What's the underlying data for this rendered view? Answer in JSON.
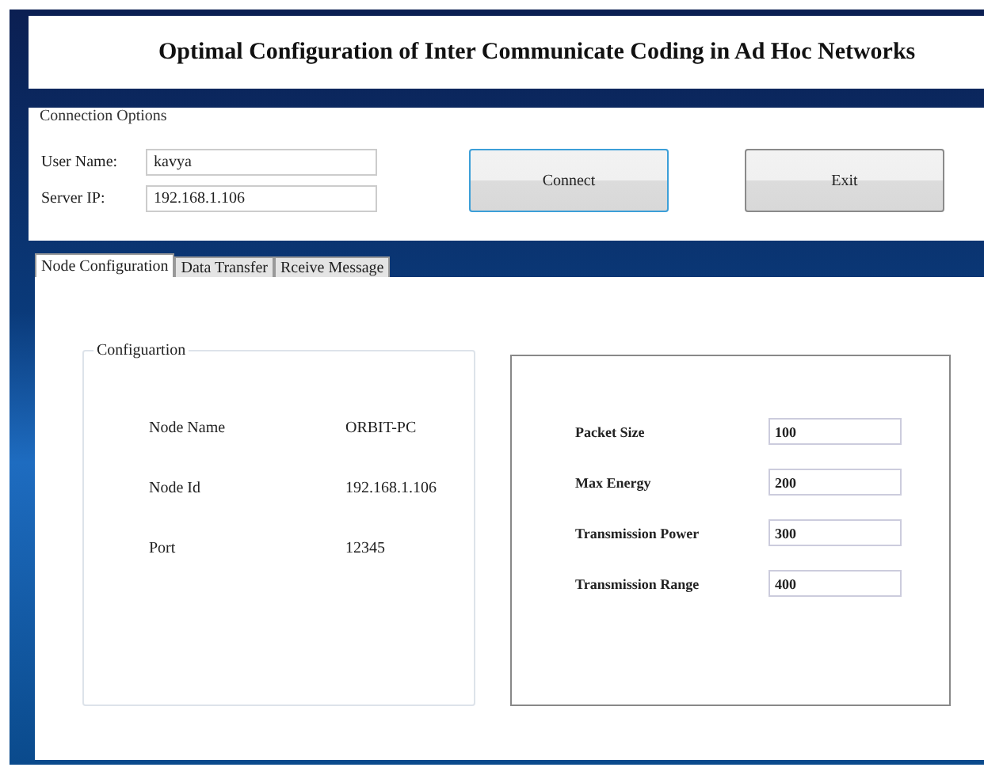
{
  "title": "Optimal Configuration of Inter Communicate  Coding in Ad Hoc Networks",
  "connection": {
    "legend": "Connection Options",
    "fields": [
      {
        "label": "User Name:",
        "value": "kavya"
      },
      {
        "label": "Server IP:",
        "value": "192.168.1.106"
      }
    ],
    "buttons": [
      {
        "label": "Connect",
        "focused": true
      },
      {
        "label": "Exit",
        "focused": false
      }
    ]
  },
  "tabs": [
    {
      "label": "Node Configuration",
      "selected": true
    },
    {
      "label": "Data Transfer",
      "selected": false
    },
    {
      "label": "Rceive Message",
      "selected": false
    }
  ],
  "configuration": {
    "legend": "Configuartion",
    "rows": [
      {
        "label": "Node Name",
        "value": "ORBIT-PC"
      },
      {
        "label": "Node Id",
        "value": "192.168.1.106"
      },
      {
        "label": "Port",
        "value": "12345"
      }
    ]
  },
  "parameters": [
    {
      "label": "Packet Size",
      "value": "100"
    },
    {
      "label": "Max Energy",
      "value": "200"
    },
    {
      "label": "Transmission Power",
      "value": "300"
    },
    {
      "label": "Transmission Range",
      "value": "400"
    }
  ]
}
